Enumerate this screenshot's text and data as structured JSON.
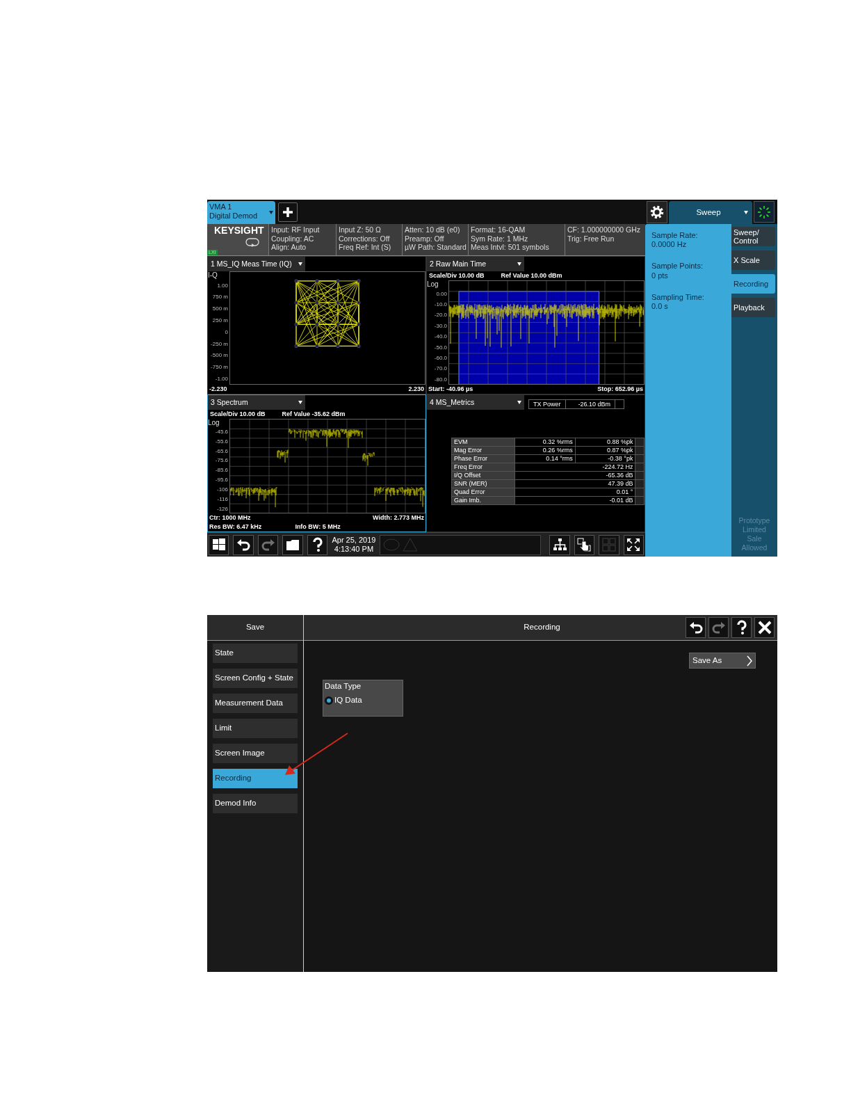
{
  "analyzer_screen": {
    "mode_tab": {
      "line1": "VMA 1",
      "line2": "Digital Demod",
      "selected": true
    },
    "sweep_menu": {
      "label": "Sweep"
    },
    "info_bar": {
      "logo": "KEYSIGHT",
      "badge": "LXI",
      "columns": [
        [
          "Input: RF Input",
          "Coupling: AC",
          "Align: Auto"
        ],
        [
          "Input Z: 50 Ω",
          "Corrections: Off",
          "Freq Ref: Int (S)"
        ],
        [
          "Atten: 10 dB (e0)",
          "Preamp: Off",
          "µW Path: Standard"
        ],
        [
          "Format: 16-QAM",
          "Sym Rate: 1 MHz",
          "Meas Intvl: 501 symbols"
        ],
        [
          "CF: 1.000000000 GHz",
          "Trig: Free Run"
        ]
      ]
    },
    "windows": [
      {
        "kind": "constellation",
        "title": "1 MS_IQ Meas Time (IQ)",
        "selected": false,
        "axis_label": "I-Q",
        "yticks": [
          "1.00",
          "750 m",
          "500 m",
          "250 m",
          "0",
          "-250 m",
          "-500 m",
          "-750 m",
          "-1.00"
        ],
        "footer": [
          "-2.230",
          "2.230"
        ]
      },
      {
        "kind": "time",
        "title": "2 Raw Main Time",
        "selected": false,
        "scale": "Scale/Div 10.00 dB",
        "ref": "Ref Value 10.00 dBm",
        "axis_label": "Log",
        "yticks": [
          "0.00",
          "-10.0",
          "-20.0",
          "-30.0",
          "-40.0",
          "-50.0",
          "-60.0",
          "-70.0",
          "-80.0"
        ],
        "footer": [
          "Start: -40.96 µs",
          "Stop: 652.96 µs"
        ]
      },
      {
        "kind": "spectrum",
        "title": "3 Spectrum",
        "selected": true,
        "scale": "Scale/Div 10.00 dB",
        "ref": "Ref Value -35.62 dBm",
        "axis_label": "Log",
        "yticks": [
          "-45.6",
          "-55.6",
          "-65.6",
          "-75.6",
          "-85.6",
          "-95.6",
          "-106",
          "-116",
          "-126"
        ],
        "footer": [
          "Ctr: 1000 MHz",
          "Width: 2.773 MHz"
        ],
        "footer2": [
          "Res BW: 6.47 kHz",
          "Info BW: 5 MHz"
        ]
      },
      {
        "kind": "metrics",
        "title": "4 MS_Metrics",
        "selected": false,
        "tx_label": "TX Power",
        "tx_value": "-26.10 dBm",
        "metrics": [
          {
            "name": "EVM",
            "values": [
              "0.32 %rms",
              "0.88 %pk"
            ]
          },
          {
            "name": "Mag Error",
            "values": [
              "0.26 %rms",
              "0.87 %pk"
            ]
          },
          {
            "name": "Phase Error",
            "values": [
              "0.14 °rms",
              "-0.38 °pk"
            ]
          },
          {
            "name": "Freq Error",
            "values": [
              "-224.72 Hz"
            ]
          },
          {
            "name": "I/Q Offset",
            "values": [
              "-65.36 dB"
            ]
          },
          {
            "name": "SNR (MER)",
            "values": [
              "47.39 dB"
            ]
          },
          {
            "name": "Quad Error",
            "values": [
              "0.01 °"
            ]
          },
          {
            "name": "Gain Imb.",
            "values": [
              "-0.01 dB"
            ]
          }
        ]
      }
    ],
    "side_panel": [
      {
        "label": "Sample Rate:",
        "value": "0.0000 Hz"
      },
      {
        "label": "Sample Points:",
        "value": "0 pts"
      },
      {
        "label": "Sampling Time:",
        "value": "0.0 s"
      }
    ],
    "softkeys": [
      {
        "label": "Sweep/ Control",
        "selected": false
      },
      {
        "label": "X Scale",
        "selected": false
      },
      {
        "label": "Recording",
        "selected": true
      },
      {
        "label": "Playback",
        "selected": false
      }
    ],
    "status_note": "Prototype Limited Sale Allowed",
    "taskbar": {
      "left_buttons": [
        {
          "kind": "windows",
          "disabled": false
        },
        {
          "kind": "undo",
          "disabled": false
        },
        {
          "kind": "redo",
          "disabled": true
        },
        {
          "kind": "folder",
          "disabled": false
        },
        {
          "kind": "help",
          "disabled": false
        }
      ],
      "date": "Apr 25, 2019",
      "time": "4:13:40 PM",
      "right_buttons": [
        {
          "kind": "layout",
          "disabled": false
        },
        {
          "kind": "touch",
          "disabled": false
        },
        {
          "kind": "grid",
          "disabled": true
        },
        {
          "kind": "expand",
          "disabled": false
        }
      ]
    }
  },
  "save_dialog": {
    "menu_title": "Save",
    "title": "Recording",
    "header_buttons": [
      {
        "kind": "undo",
        "disabled": false
      },
      {
        "kind": "redo",
        "disabled": true
      },
      {
        "kind": "help",
        "disabled": false
      },
      {
        "kind": "close",
        "disabled": false
      }
    ],
    "items": [
      {
        "label": "State",
        "selected": false
      },
      {
        "label": "Screen Config + State",
        "selected": false
      },
      {
        "label": "Measurement Data",
        "selected": false
      },
      {
        "label": "Limit",
        "selected": false
      },
      {
        "label": "Screen Image",
        "selected": false
      },
      {
        "label": "Recording",
        "selected": true
      },
      {
        "label": "Demod Info",
        "selected": false
      }
    ],
    "save_as": "Save As",
    "group": {
      "title": "Data Type",
      "options": [
        {
          "label": "IQ Data",
          "selected": true
        }
      ]
    }
  }
}
